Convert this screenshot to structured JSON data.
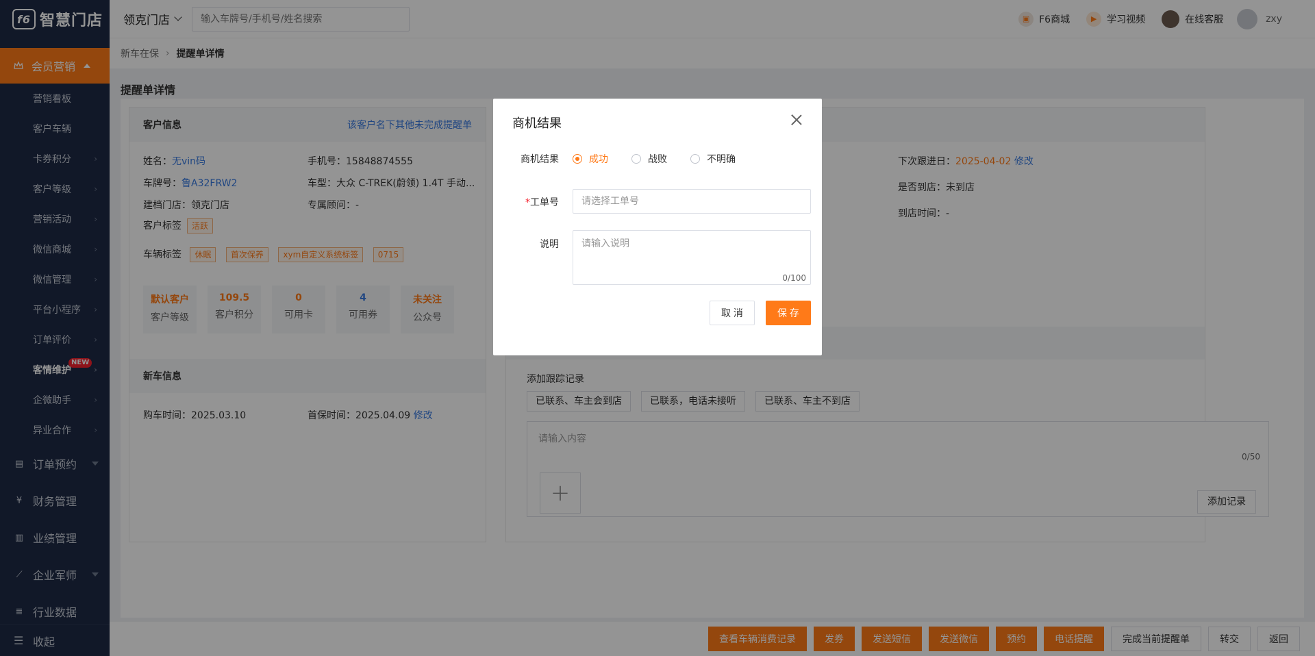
{
  "app": {
    "logo_text": "智慧门店"
  },
  "sidebar": {
    "active_group": "会员营销",
    "sub_items": [
      {
        "label": "营销看板",
        "chevron": false
      },
      {
        "label": "客户车辆",
        "chevron": false
      },
      {
        "label": "卡券积分",
        "chevron": true
      },
      {
        "label": "客户等级",
        "chevron": true
      },
      {
        "label": "营销活动",
        "chevron": true
      },
      {
        "label": "微信商城",
        "chevron": true
      },
      {
        "label": "微信管理",
        "chevron": true
      },
      {
        "label": "平台小程序",
        "chevron": true
      },
      {
        "label": "订单评价",
        "chevron": true
      },
      {
        "label": "客情维护",
        "chevron": true,
        "badge": "NEW"
      },
      {
        "label": "企微助手",
        "chevron": true
      },
      {
        "label": "异业合作",
        "chevron": true
      }
    ],
    "groups": [
      {
        "label": "订单预约",
        "icon": "clipboard-icon"
      },
      {
        "label": "财务管理",
        "icon": "yen-icon"
      },
      {
        "label": "业绩管理",
        "icon": "bar-chart-icon"
      },
      {
        "label": "企业军师",
        "icon": "line-chart-icon"
      },
      {
        "label": "行业数据",
        "icon": "database-icon"
      }
    ],
    "collapse_label": "收起"
  },
  "header": {
    "store": "领克门店",
    "search_placeholder": "输入车牌号/手机号/姓名搜索",
    "links": [
      {
        "label": "F6商城",
        "icon": "store-icon"
      },
      {
        "label": "学习视频",
        "icon": "play-icon"
      },
      {
        "label": "在线客服",
        "icon": "support-avatar"
      }
    ],
    "username": "zxy"
  },
  "breadcrumb": {
    "parent": "新车在保",
    "current": "提醒单详情"
  },
  "page": {
    "title": "提醒单详情",
    "customer": {
      "heading": "客户信息",
      "other_reminders_link": "该客户名下其他未完成提醒单",
      "name_label": "姓名：",
      "name_value": "无vin码",
      "phone_label": "手机号：",
      "phone_value": "15848874555",
      "plate_label": "车牌号：",
      "plate_value": "鲁A32FRW2",
      "model_label": "车型：",
      "model_value": "大众 C-TREK(蔚领) 1.4T 手动...",
      "store_label": "建档门店：",
      "store_value": "领克门店",
      "advisor_label": "专属顾问：",
      "advisor_value": "-",
      "customer_tag_label": "客户标签",
      "customer_tags": [
        "活跃"
      ],
      "vehicle_tag_label": "车辆标签",
      "vehicle_tags": [
        "休眠",
        "首次保养",
        "xym自定义系统标签",
        "0715"
      ],
      "stats": [
        {
          "value": "默认客户",
          "label": "客户等级",
          "color": "#ff7a18"
        },
        {
          "value": "109.5",
          "label": "客户积分",
          "color": "#ff7a18"
        },
        {
          "value": "0",
          "label": "可用卡",
          "color": "#ff7a18"
        },
        {
          "value": "4",
          "label": "可用券",
          "color": "#3a7be0"
        },
        {
          "value": "未关注",
          "label": "公众号",
          "color": "#ff7a18"
        }
      ]
    },
    "new_car": {
      "heading": "新车信息",
      "buy_label": "购车时间：",
      "buy_value": "2025.03.10",
      "first_maint_label": "首保时间：",
      "first_maint_value": "2025.04.09",
      "edit_label": "修改"
    },
    "followup": {
      "next_date_label": "下次跟进日：",
      "next_date_value": "2025-04-02",
      "edit_label": "修改",
      "visited_label": "是否到店：",
      "visited_value": "未到店",
      "visit_time_label": "到店时间：",
      "visit_time_value": "-",
      "add_record_title": "添加跟踪记录",
      "quick_replies": [
        "已联系、车主会到店",
        "已联系，电话未接听",
        "已联系、车主不到店"
      ],
      "content_placeholder": "请输入内容",
      "content_count": "0/50",
      "add_record_button": "添加记录"
    }
  },
  "bottom_actions": [
    {
      "label": "查看车辆消费记录",
      "style": "orange"
    },
    {
      "label": "发券",
      "style": "orange"
    },
    {
      "label": "发送短信",
      "style": "orange"
    },
    {
      "label": "发送微信",
      "style": "orange"
    },
    {
      "label": "预约",
      "style": "orange"
    },
    {
      "label": "电话提醒",
      "style": "orange"
    },
    {
      "label": "完成当前提醒单",
      "style": "white"
    },
    {
      "label": "转交",
      "style": "white"
    },
    {
      "label": "返回",
      "style": "white"
    }
  ],
  "modal": {
    "title": "商机结果",
    "result_label": "商机结果",
    "options": [
      {
        "label": "成功",
        "checked": true
      },
      {
        "label": "战败",
        "checked": false
      },
      {
        "label": "不明确",
        "checked": false
      }
    ],
    "work_order_label": "工单号",
    "work_order_placeholder": "请选择工单号",
    "note_label": "说明",
    "note_placeholder": "请输入说明",
    "note_count": "0/100",
    "cancel_label": "取 消",
    "save_label": "保 存"
  },
  "colors": {
    "accent": "#ff7a18",
    "sidebar_bg": "#1e2a45",
    "link": "#3a7be0"
  }
}
